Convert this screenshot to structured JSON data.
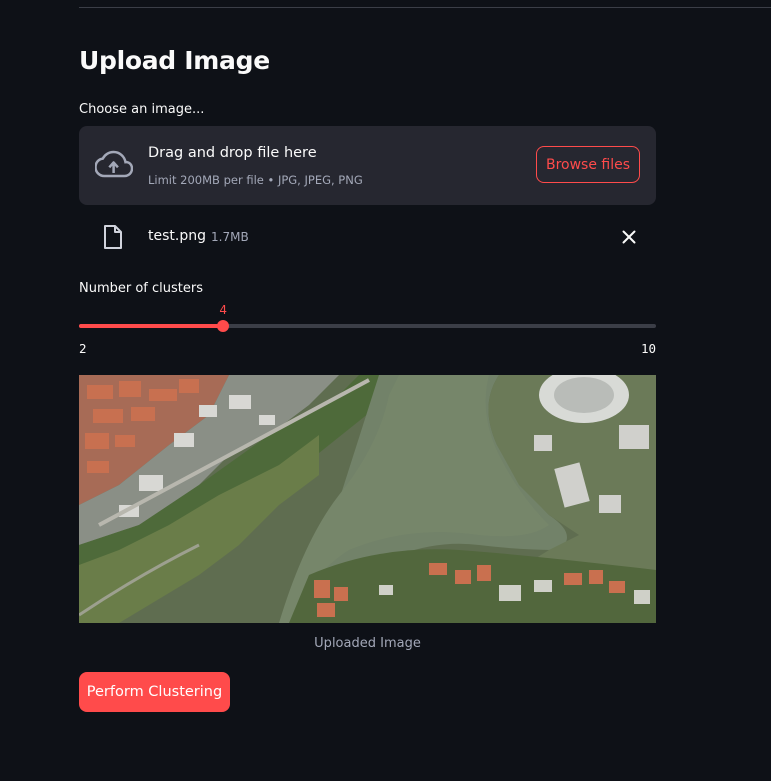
{
  "page": {
    "title": "Upload Image"
  },
  "uploader": {
    "label": "Choose an image...",
    "drop_title": "Drag and drop file here",
    "drop_hint": "Limit 200MB per file • JPG, JPEG, PNG",
    "browse_label": "Browse files",
    "icon": "cloud-upload-icon"
  },
  "uploaded_file": {
    "name": "test.png",
    "size": "1.7MB",
    "icon": "file-icon",
    "remove_icon": "close-icon"
  },
  "slider": {
    "label": "Number of clusters",
    "value": 4,
    "value_label": "4",
    "min": 2,
    "max": 10,
    "min_label": "2",
    "max_label": "10"
  },
  "image": {
    "caption": "Uploaded Image"
  },
  "actions": {
    "cluster_label": "Perform Clustering"
  },
  "colors": {
    "background": "#0e1117",
    "panel": "#262730",
    "accent": "#ff4b4b",
    "text": "#fafafa",
    "muted": "#a3a8b8",
    "track": "#3b3e47"
  }
}
